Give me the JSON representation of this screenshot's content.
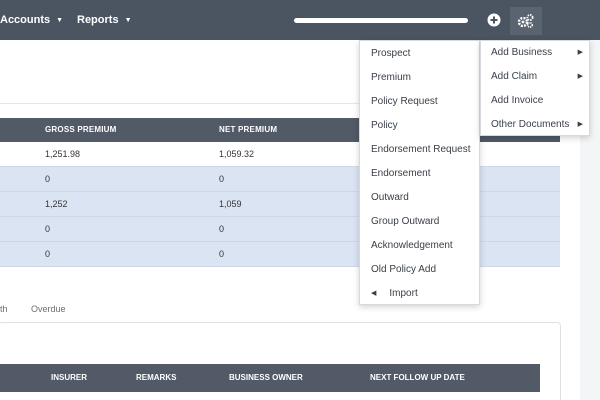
{
  "nav": {
    "accounts_label": "Accounts",
    "reports_label": "Reports",
    "caret": "▼",
    "plus_icon": "plus-circle-icon",
    "gear_icon": "gears-icon"
  },
  "premium_table": {
    "headers": [
      "GROSS PREMIUM",
      "NET PREMIUM"
    ],
    "rows": [
      [
        "1,251.98",
        "1,059.32"
      ],
      [
        "0",
        "0"
      ],
      [
        "1,252",
        "1,059"
      ],
      [
        "0",
        "0"
      ],
      [
        "0",
        "0"
      ]
    ]
  },
  "tabs": [
    "th",
    "Overdue"
  ],
  "followup_table": {
    "headers": [
      "INSURER",
      "REMARKS",
      "BUSINESS OWNER",
      "NEXT FOLLOW UP DATE"
    ]
  },
  "dropdown": {
    "items": [
      "Prospect",
      "Premium",
      "Policy Request",
      "Policy",
      "Endorsement Request",
      "Endorsement",
      "Outward",
      "Group Outward",
      "Acknowledgement",
      "Old Policy Add"
    ],
    "import_label": "Import",
    "import_arrow": "◀"
  },
  "submenu": {
    "items": [
      {
        "label": "Add Business",
        "arrow": "▶"
      },
      {
        "label": "Add Claim",
        "arrow": "▶"
      },
      {
        "label": "Add Invoice",
        "arrow": ""
      },
      {
        "label": "Other Documents",
        "arrow": "▶"
      }
    ]
  },
  "colors": {
    "nav_bg": "#4b5461",
    "table_header_bg": "#515a66",
    "row_highlight": "#dbe4f3"
  }
}
